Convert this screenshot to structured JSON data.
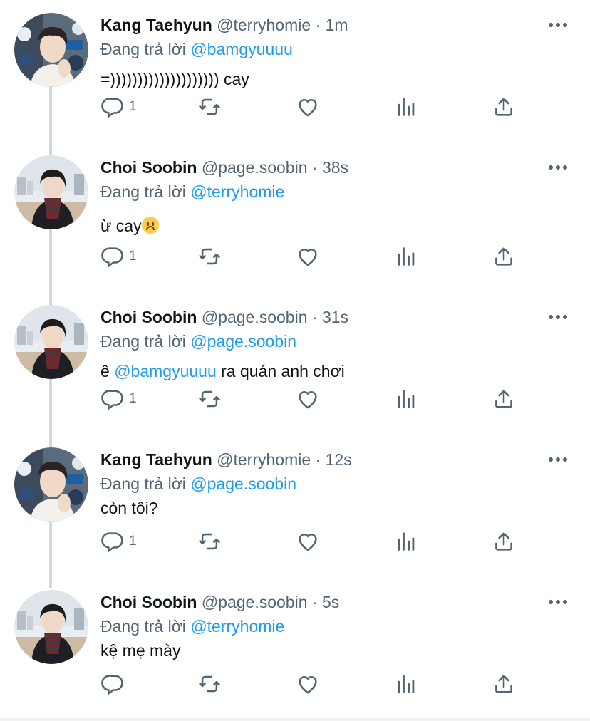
{
  "thread": [
    {
      "avatar": "avatar-taehyun",
      "name": "Kang Taehyun",
      "handle": "@terryhomie",
      "dot": "·",
      "time": "1m",
      "replying_prefix": "Đang trả lời",
      "replying_to": "@bamgyuuuu",
      "text": "=)))))))))))))))))))) cay",
      "reply_count": "1"
    },
    {
      "avatar": "avatar-soobin",
      "name": "Choi Soobin",
      "handle": "@page.soobin",
      "dot": "·",
      "time": "38s",
      "replying_prefix": "Đang trả lời",
      "replying_to": "@terryhomie",
      "text": "ừ cay",
      "emoji": "upside-down-face-emoji",
      "reply_count": "1"
    },
    {
      "avatar": "avatar-soobin",
      "name": "Choi Soobin",
      "handle": "@page.soobin",
      "dot": "·",
      "time": "31s",
      "replying_prefix": "Đang trả lời",
      "replying_to": "@page.soobin",
      "text_before": "ê ",
      "text_mention": "@bamgyuuuu",
      "text_after": " ra quán anh chơi",
      "reply_count": "1"
    },
    {
      "avatar": "avatar-taehyun",
      "name": "Kang Taehyun",
      "handle": "@terryhomie",
      "dot": "·",
      "time": "12s",
      "replying_prefix": "Đang trả lời",
      "replying_to": "@page.soobin",
      "text": "còn tôi?",
      "reply_count": "1"
    },
    {
      "avatar": "avatar-soobin",
      "name": "Choi Soobin",
      "handle": "@page.soobin",
      "dot": "·",
      "time": "5s",
      "replying_prefix": "Đang trả lời",
      "replying_to": "@terryhomie",
      "text": "kệ mẹ mày",
      "reply_count": ""
    }
  ],
  "icons": {
    "reply": "reply-icon",
    "retweet": "retweet-icon",
    "like": "heart-icon",
    "views": "analytics-icon",
    "share": "share-icon",
    "more": "more-icon"
  },
  "colors": {
    "text": "#0f1419",
    "secondary": "#536471",
    "link": "#1d9bf0",
    "thread_line": "#cfd9de"
  }
}
